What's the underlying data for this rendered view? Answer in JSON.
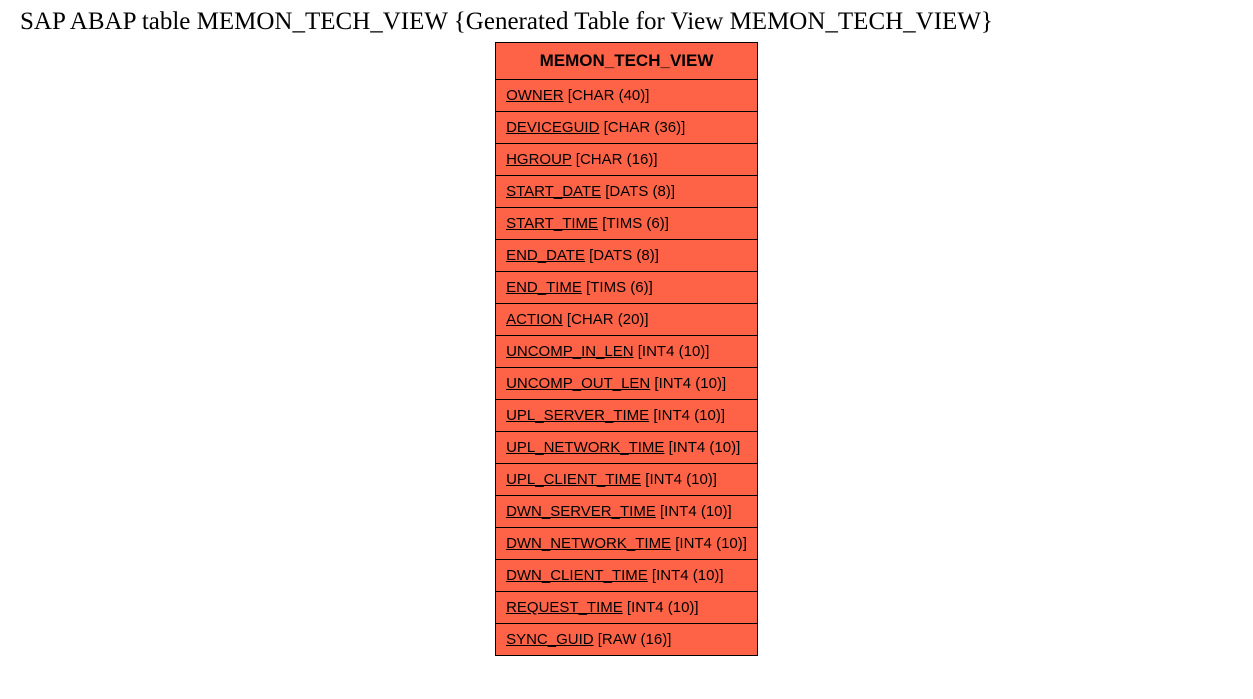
{
  "title": "SAP ABAP table MEMON_TECH_VIEW {Generated Table for View MEMON_TECH_VIEW}",
  "table": {
    "name": "MEMON_TECH_VIEW",
    "fields": [
      {
        "name": "OWNER",
        "type": "[CHAR (40)]"
      },
      {
        "name": "DEVICEGUID",
        "type": "[CHAR (36)]"
      },
      {
        "name": "HGROUP",
        "type": "[CHAR (16)]"
      },
      {
        "name": "START_DATE",
        "type": "[DATS (8)]"
      },
      {
        "name": "START_TIME",
        "type": "[TIMS (6)]"
      },
      {
        "name": "END_DATE",
        "type": "[DATS (8)]"
      },
      {
        "name": "END_TIME",
        "type": "[TIMS (6)]"
      },
      {
        "name": "ACTION",
        "type": "[CHAR (20)]"
      },
      {
        "name": "UNCOMP_IN_LEN",
        "type": "[INT4 (10)]"
      },
      {
        "name": "UNCOMP_OUT_LEN",
        "type": "[INT4 (10)]"
      },
      {
        "name": "UPL_SERVER_TIME",
        "type": "[INT4 (10)]"
      },
      {
        "name": "UPL_NETWORK_TIME",
        "type": "[INT4 (10)]"
      },
      {
        "name": "UPL_CLIENT_TIME",
        "type": "[INT4 (10)]"
      },
      {
        "name": "DWN_SERVER_TIME",
        "type": "[INT4 (10)]"
      },
      {
        "name": "DWN_NETWORK_TIME",
        "type": "[INT4 (10)]"
      },
      {
        "name": "DWN_CLIENT_TIME",
        "type": "[INT4 (10)]"
      },
      {
        "name": "REQUEST_TIME",
        "type": "[INT4 (10)]"
      },
      {
        "name": "SYNC_GUID",
        "type": "[RAW (16)]"
      }
    ]
  }
}
